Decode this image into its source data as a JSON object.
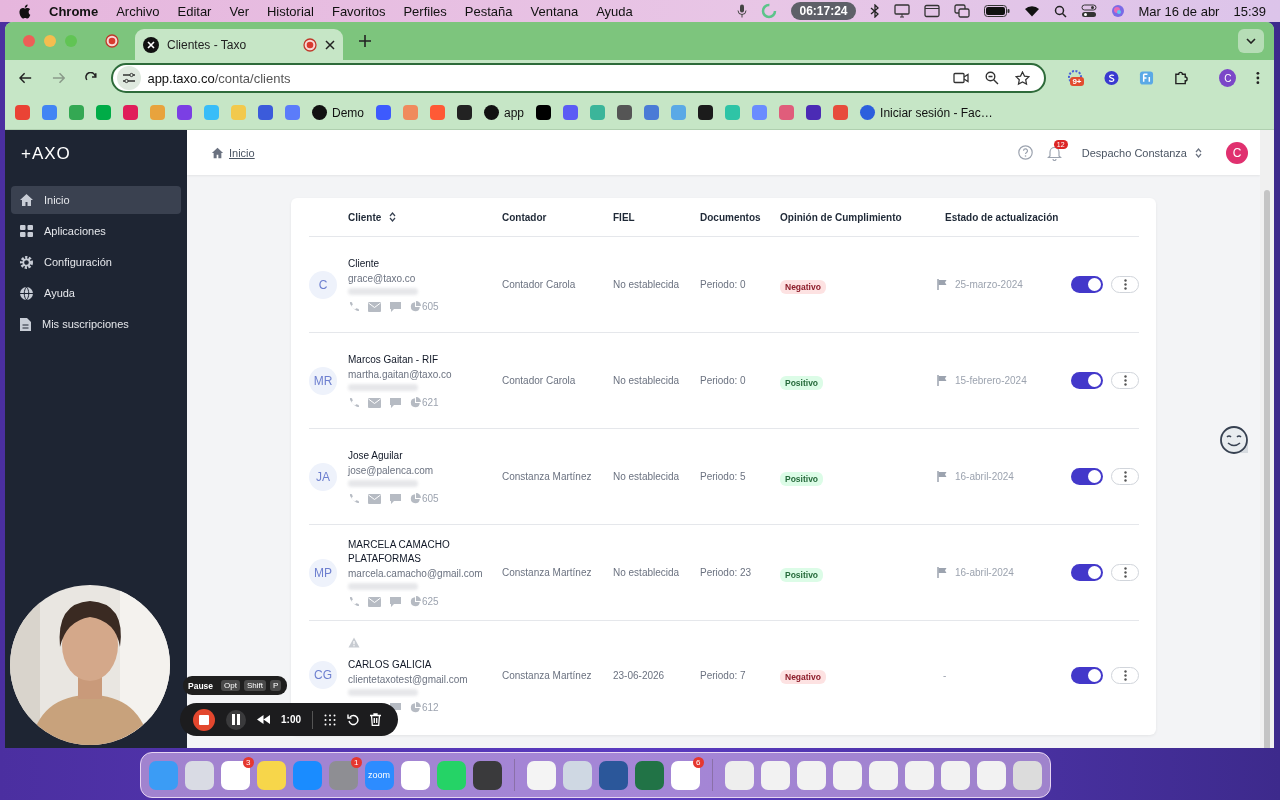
{
  "menubar": {
    "app": "Chrome",
    "menus": [
      "Archivo",
      "Editar",
      "Ver",
      "Historial",
      "Favoritos",
      "Perfiles",
      "Pestaña",
      "Ventana",
      "Ayuda"
    ],
    "timer": "06:17:24",
    "date": "Mar 16 de abr",
    "time": "15:39"
  },
  "browser": {
    "tabs": [
      {
        "title": "Clientes - Taxo",
        "selected": true
      }
    ],
    "url_host": "app.taxo.co",
    "url_path": "/conta/clients",
    "extension_badge": "9+",
    "profile": "C",
    "bookmarks": [
      {
        "color": "#ea4335"
      },
      {
        "color": "#4285f4"
      },
      {
        "color": "#34a853"
      },
      {
        "color": "#00ac47"
      },
      {
        "color": "#e01e5a"
      },
      {
        "color": "#e8a33d"
      },
      {
        "color": "#7b3fe4"
      },
      {
        "color": "#38bdf8"
      },
      {
        "color": "#f2c94c"
      },
      {
        "color": "#3b5bdb"
      },
      {
        "color": "#5b7cfa"
      },
      {
        "color": "#111111",
        "label": "Demo"
      },
      {
        "color": "#3d5afe"
      },
      {
        "color": "#f08a5d"
      },
      {
        "color": "#ff5a36"
      },
      {
        "color": "#222222"
      },
      {
        "color": "#111111",
        "label": "app"
      },
      {
        "color": "#000000"
      },
      {
        "color": "#5b5bf5"
      },
      {
        "color": "#3bb59a"
      },
      {
        "color": "#555555"
      },
      {
        "color": "#4a7bd6"
      },
      {
        "color": "#5aa9e6"
      },
      {
        "color": "#1b1b1b"
      },
      {
        "color": "#2ec4a6"
      },
      {
        "color": "#6a8cff"
      },
      {
        "color": "#e05d7b"
      },
      {
        "color": "#4b2bb5"
      },
      {
        "color": "#e74c3c"
      },
      {
        "color": "#2c5fdd",
        "label": "Iniciar sesión - Fac…"
      }
    ]
  },
  "app": {
    "logo": "+AXO",
    "sidebar": [
      {
        "label": "Inicio",
        "selected": true
      },
      {
        "label": "Aplicaciones",
        "selected": false
      },
      {
        "label": "Configuración",
        "selected": false
      },
      {
        "label": "Ayuda",
        "selected": false
      },
      {
        "label": "Mis suscripciones",
        "selected": false
      }
    ],
    "breadcrumb": "Inicio",
    "notifications": "12",
    "organization": "Despacho Constanza",
    "avatar": "C",
    "table": {
      "columns": [
        "Cliente",
        "Contador",
        "FIEL",
        "Documentos",
        "Opinión de Cumplimiento",
        "Estado de actualización"
      ],
      "rows": [
        {
          "initials": "C",
          "name": "Cliente",
          "email": "grace@taxo.co",
          "contact_icons": [
            {
              "kind": "phone"
            },
            {
              "kind": "mail"
            },
            {
              "kind": "chat"
            }
          ],
          "count": "605",
          "contador": "Contador Carola",
          "fiel": "No establecida",
          "documentos": "Periodo: 0",
          "opinion": {
            "label": "Negativo",
            "kind": "negative"
          },
          "estado": "25-marzo-2024",
          "flag": true,
          "warning": false,
          "active": true
        },
        {
          "initials": "MR",
          "name": "Marcos Gaitan - RIF",
          "email": "martha.gaitan@taxo.co",
          "contact_icons": [
            {
              "kind": "phone"
            },
            {
              "kind": "mail"
            },
            {
              "kind": "chat"
            }
          ],
          "count": "621",
          "contador": "Contador Carola",
          "fiel": "No establecida",
          "documentos": "Periodo: 0",
          "opinion": {
            "label": "Positivo",
            "kind": "positive"
          },
          "estado": "15-febrero-2024",
          "flag": true,
          "warning": false,
          "active": true
        },
        {
          "initials": "JA",
          "name": "Jose Aguilar",
          "email": "jose@palenca.com",
          "contact_icons": [
            {
              "kind": "phone"
            },
            {
              "kind": "mail"
            },
            {
              "kind": "chat"
            }
          ],
          "count": "605",
          "contador": "Constanza Martínez",
          "fiel": "No establecida",
          "documentos": "Periodo: 5",
          "opinion": {
            "label": "Positivo",
            "kind": "positive"
          },
          "estado": "16-abril-2024",
          "flag": true,
          "warning": false,
          "active": true
        },
        {
          "initials": "MP",
          "name": "MARCELA CAMACHO PLATAFORMAS",
          "email": "marcela.camacho@gmail.com",
          "contact_icons": [
            {
              "kind": "phone"
            },
            {
              "kind": "mail"
            },
            {
              "kind": "chat"
            }
          ],
          "count": "625",
          "contador": "Constanza Martínez",
          "fiel": "No establecida",
          "documentos": "Periodo: 23",
          "opinion": {
            "label": "Positivo",
            "kind": "positive"
          },
          "estado": "16-abril-2024",
          "flag": true,
          "warning": false,
          "active": true
        },
        {
          "initials": "CG",
          "name": "CARLOS GALICIA",
          "email": "clientetaxotest@gmail.com",
          "contact_icons": [
            {
              "kind": "chat"
            }
          ],
          "count": "612",
          "contador": "Constanza Martínez",
          "fiel": "23-06-2026",
          "documentos": "Periodo: 7",
          "opinion": {
            "label": "Negativo",
            "kind": "negative"
          },
          "estado": "-",
          "flag": false,
          "warning": true,
          "active": true
        }
      ]
    }
  },
  "recorder": {
    "tooltip": "Pause",
    "keys": [
      "Opt",
      "Shift",
      "P"
    ],
    "elapsed": "1:00"
  },
  "dock": [
    {
      "apps": [
        {
          "color": "#3b9cf5"
        },
        {
          "color": "#d9dbe4"
        },
        {
          "color": "#ffffff",
          "badge": "3"
        },
        {
          "color": "#f7d64a"
        },
        {
          "color": "#1a8cff"
        },
        {
          "color": "#8e8e93",
          "badge": "1"
        },
        {
          "color": "#2d8cff",
          "label": "zoom"
        },
        {
          "color": "#ffffff"
        },
        {
          "color": "#25d366"
        },
        {
          "color": "#3a3a3c"
        }
      ]
    },
    {
      "apps": [
        {
          "color": "#f4f4f4"
        },
        {
          "color": "#cfd8e3"
        },
        {
          "color": "#2b579a"
        },
        {
          "color": "#217346"
        },
        {
          "color": "#ffffff",
          "badge": "6"
        }
      ]
    },
    {
      "apps": [
        {
          "color": "#eeeeee"
        },
        {
          "color": "#f2f2f2"
        },
        {
          "color": "#f2f2f2"
        },
        {
          "color": "#f2f2f2"
        },
        {
          "color": "#f2f2f2"
        },
        {
          "color": "#f2f2f2"
        },
        {
          "color": "#f2f2f2"
        },
        {
          "color": "#f2f2f2"
        },
        {
          "color": "#dcdcdc"
        }
      ]
    }
  ]
}
